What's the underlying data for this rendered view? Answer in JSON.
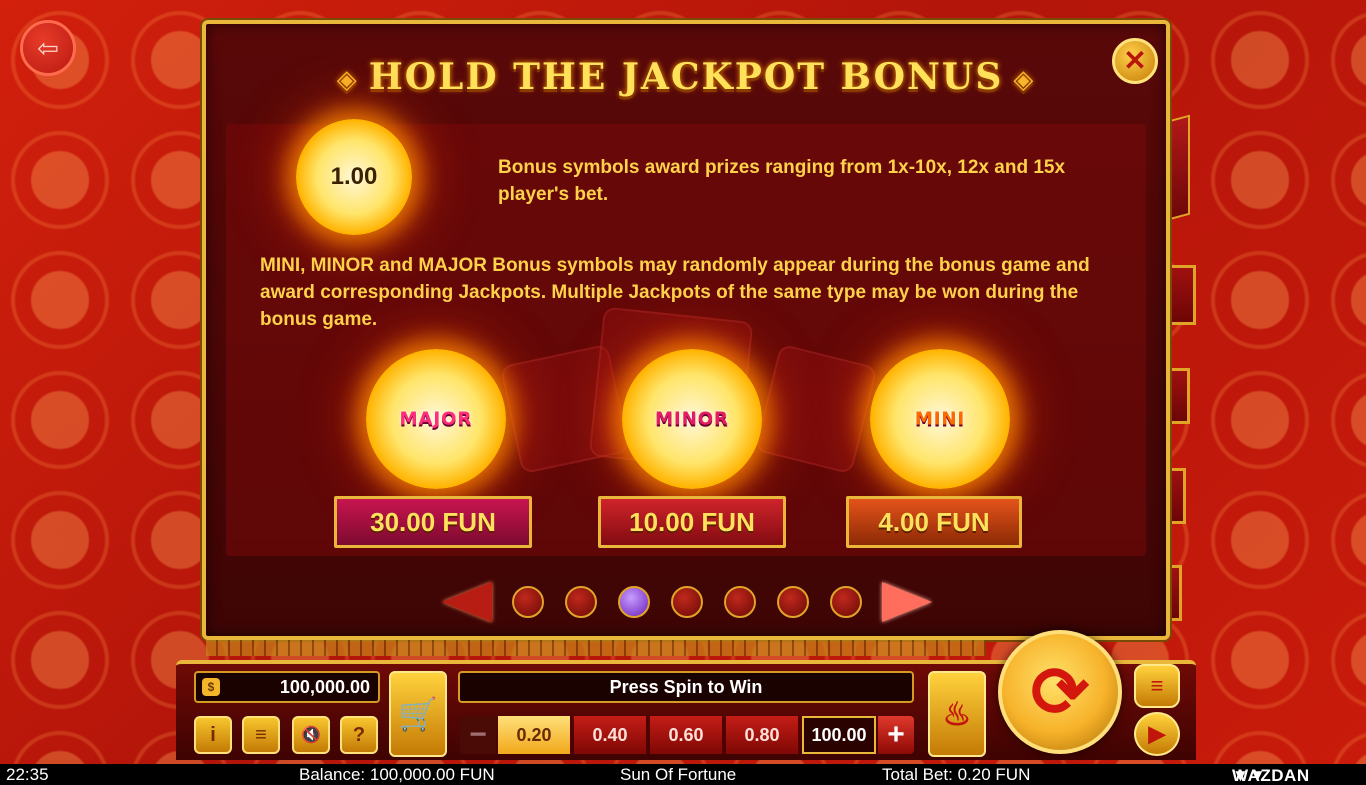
{
  "bonus_panel": {
    "title": "HOLD THE JACKPOT BONUS",
    "close_icon": "close-icon",
    "sample_symbol_value": "1.00",
    "intro_text": "Bonus symbols award prizes ranging from 1x-10x, 12x and 15x player's bet.",
    "jackpot_text": "MINI, MINOR and MAJOR Bonus symbols may randomly appear during the bonus game and award corresponding Jackpots. Multiple Jackpots of the same type may be won during the bonus game.",
    "jackpots": [
      {
        "tag": "MAJOR",
        "amount": "30.00 FUN"
      },
      {
        "tag": "MINOR",
        "amount": "10.00 FUN"
      },
      {
        "tag": "MINI",
        "amount": "4.00 FUN"
      }
    ],
    "pager": {
      "pages": 7,
      "current": 3
    }
  },
  "controls": {
    "balance": "100,000.00",
    "status_text": "Press Spin to Win",
    "bet_options": [
      "0.20",
      "0.40",
      "0.60",
      "0.80",
      "100.00"
    ],
    "selected_bet": "0.20",
    "minus_label": "−",
    "plus_label": "+",
    "info_label": "i",
    "menu_label": "≡",
    "sound_label": "🔇",
    "help_label": "?"
  },
  "footer": {
    "time": "22:35",
    "balance": "Balance: 100,000.00 FUN",
    "game_name": "Sun Of Fortune",
    "total_bet": "Total Bet: 0.20 FUN",
    "brand": "WAZDAN"
  },
  "colors": {
    "accent_gold": "#e9b73a",
    "title_yellow": "#ffe15a",
    "text_yellow": "#ffd24a",
    "active_dot": "#8a3ad8"
  }
}
